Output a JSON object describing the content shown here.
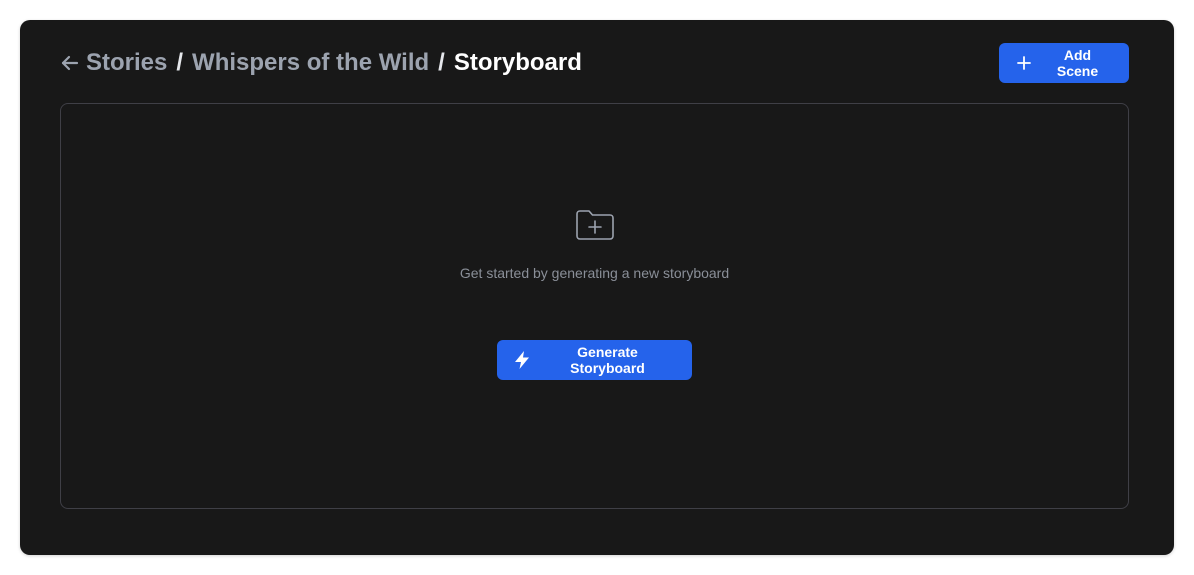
{
  "breadcrumb": {
    "items": [
      "Stories",
      "Whispers of the Wild"
    ],
    "separator": "/",
    "current": "Storyboard"
  },
  "header": {
    "add_scene_label": "Add Scene"
  },
  "empty_state": {
    "icon": "folder-plus-icon",
    "message": "Get started by generating a new storyboard",
    "generate_label": "Generate Storyboard"
  },
  "colors": {
    "panel_background": "#181818",
    "accent": "#2563eb",
    "muted_text": "#9ca3af",
    "border": "#3f3f46"
  }
}
